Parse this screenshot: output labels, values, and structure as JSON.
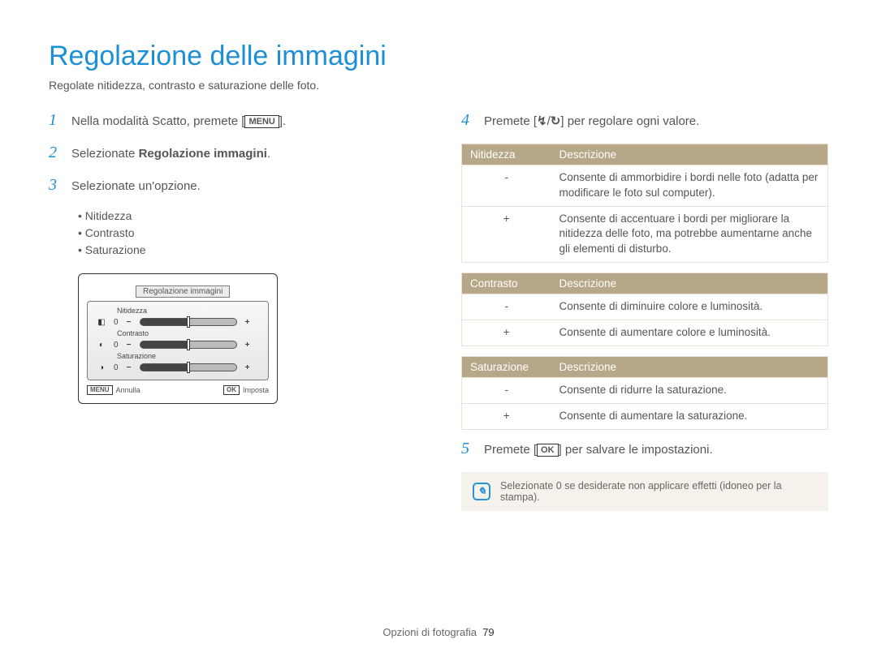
{
  "title": "Regolazione delle immagini",
  "subtitle": "Regolate nitidezza, contrasto e saturazione delle foto.",
  "left": {
    "steps": {
      "1": {
        "full": "Nella modalità Scatto, premete [",
        "tail": "].",
        "key": "MENU"
      },
      "2": {
        "before": "Selezionate ",
        "bold": "Regolazione immagini",
        "after": "."
      },
      "3": {
        "text": "Selezionate un'opzione."
      }
    },
    "sublist": [
      "Nitidezza",
      "Contrasto",
      "Saturazione"
    ],
    "panel": {
      "title": "Regolazione immagini",
      "rows": [
        {
          "icon": "◧",
          "zero": "0",
          "label": "Nitidezza",
          "minus": "−",
          "plus": "+"
        },
        {
          "icon": "◐",
          "zero": "0",
          "label": "Contrasto",
          "minus": "−",
          "plus": "+"
        },
        {
          "icon": "◑",
          "zero": "0",
          "label": "Saturazione",
          "minus": "−",
          "plus": "+"
        }
      ],
      "foot_left_key": "MENU",
      "foot_left_text": "Annulla",
      "foot_right_key": "OK",
      "foot_right_text": "Imposta"
    }
  },
  "right": {
    "step4": {
      "before": "Premete [",
      "icon_left": "↯",
      "sep": "/",
      "icon_right": "↻",
      "after_bracket": "]",
      "tail": " per regolare ogni valore."
    },
    "step5": {
      "before": "Premete [",
      "key": "OK",
      "after_bracket": "]",
      "tail": " per salvare le impostazioni."
    },
    "tables": [
      {
        "headers": [
          "Nitidezza",
          "Descrizione"
        ],
        "rows": [
          {
            "k": "-",
            "v": "Consente di ammorbidire i bordi nelle foto (adatta per modificare le foto sul computer)."
          },
          {
            "k": "+",
            "v": "Consente di accentuare i bordi per migliorare la nitidezza delle foto, ma potrebbe aumentarne anche gli elementi di disturbo."
          }
        ]
      },
      {
        "headers": [
          "Contrasto",
          "Descrizione"
        ],
        "rows": [
          {
            "k": "-",
            "v": "Consente di diminuire colore e luminosità."
          },
          {
            "k": "+",
            "v": "Consente di aumentare colore e luminosità."
          }
        ]
      },
      {
        "headers": [
          "Saturazione",
          "Descrizione"
        ],
        "rows": [
          {
            "k": "-",
            "v": "Consente di ridurre la saturazione."
          },
          {
            "k": "+",
            "v": "Consente di aumentare la saturazione."
          }
        ]
      }
    ],
    "note": "Selezionate 0 se desiderate non applicare effetti (idoneo per la stampa)."
  },
  "footer": {
    "section": "Opzioni di fotografia",
    "page": "79"
  }
}
